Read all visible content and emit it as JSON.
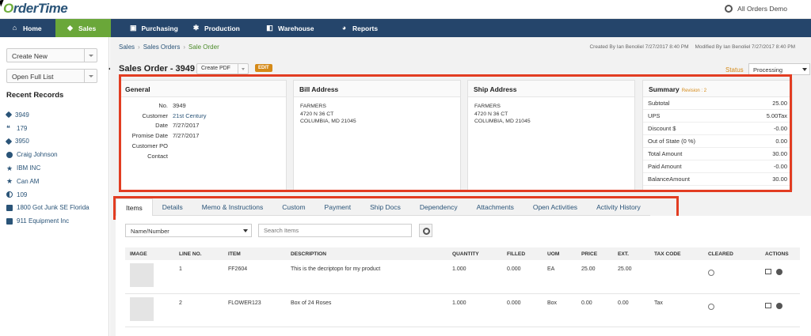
{
  "app": {
    "logo": "OrderTime",
    "account_link": "All Orders Demo"
  },
  "nav": [
    {
      "label": "Home",
      "icon": "home-icon",
      "active": false
    },
    {
      "label": "Sales",
      "icon": "tag-icon",
      "active": true
    },
    {
      "label": "Purchasing",
      "icon": "cart-icon",
      "active": false
    },
    {
      "label": "Production",
      "icon": "gears-icon",
      "active": false
    },
    {
      "label": "Warehouse",
      "icon": "box-icon",
      "active": false
    },
    {
      "label": "Reports",
      "icon": "pie-chart-icon",
      "active": false
    }
  ],
  "sidebar": {
    "create_new": "Create New",
    "open_full_list": "Open Full List",
    "recent_title": "Recent Records",
    "recent": [
      {
        "label": "3949",
        "icon": "tag-icon"
      },
      {
        "label": "179",
        "icon": "quote-icon"
      },
      {
        "label": "3950",
        "icon": "tag-icon"
      },
      {
        "label": "Craig Johnson",
        "icon": "user-icon"
      },
      {
        "label": "IBM INC",
        "icon": "star-icon"
      },
      {
        "label": "Can AM",
        "icon": "star-icon"
      },
      {
        "label": "109",
        "icon": "half-circle-icon"
      },
      {
        "label": "1800 Got Junk SE Florida",
        "icon": "vendor-icon"
      },
      {
        "label": "911 Equipment Inc",
        "icon": "vendor-icon"
      }
    ]
  },
  "breadcrumb": {
    "items": [
      "Sales",
      "Sales Orders",
      "Sale Order"
    ]
  },
  "meta": {
    "created": "Created By Ian Benoliel 7/27/2017 8:40 PM",
    "modified": "Modified By Ian Benoliel 7/27/2017 8:40 PM"
  },
  "header": {
    "title": "Sales Order - 3949",
    "create_pdf": "Create PDF",
    "edit": "EDIT",
    "status_label": "Status",
    "status_value": "Processing"
  },
  "general": {
    "title": "General",
    "fields": [
      {
        "label": "No.",
        "value": "3949",
        "link": false
      },
      {
        "label": "Customer",
        "value": "21st Century",
        "link": true
      },
      {
        "label": "Date",
        "value": "7/27/2017",
        "link": false
      },
      {
        "label": "Promise Date",
        "value": "7/27/2017",
        "link": false
      },
      {
        "label": "Customer PO",
        "value": "",
        "link": false
      },
      {
        "label": "Contact",
        "value": "",
        "link": false
      }
    ]
  },
  "bill": {
    "title": "Bill Address",
    "name": "FARMERS",
    "line1": "4720 N 36 CT",
    "line2": "COLUMBIA, MD 21045"
  },
  "ship": {
    "title": "Ship Address",
    "name": "FARMERS",
    "line1": "4720 N 36 CT",
    "line2": "COLUMBIA, MD 21045"
  },
  "summary": {
    "title": "Summary",
    "revision": "Revision : 2",
    "rows": [
      {
        "label": "Subtotal",
        "value": "25.00"
      },
      {
        "label": "UPS",
        "value": "5.00Tax"
      },
      {
        "label": "Discount $",
        "value": "-0.00"
      },
      {
        "label": "Out of State (0 %)",
        "value": "0.00"
      },
      {
        "label": "Total Amount",
        "value": "30.00"
      },
      {
        "label": "Paid Amount",
        "value": "-0.00"
      },
      {
        "label": "BalanceAmount",
        "value": "30.00"
      }
    ]
  },
  "tabs": [
    "Items",
    "Details",
    "Memo & Instructions",
    "Custom",
    "Payment",
    "Ship Docs",
    "Dependency",
    "Attachments",
    "Open Activities",
    "Activity History"
  ],
  "items_toolbar": {
    "filter_value": "Name/Number",
    "search_placeholder": "Search Items"
  },
  "items_table": {
    "columns": [
      "IMAGE",
      "LINE NO.",
      "ITEM",
      "DESCRIPTION",
      "QUANTITY",
      "FILLED",
      "UOM",
      "PRICE",
      "EXT.",
      "TAX CODE",
      "CLEARED",
      "ACTIONS"
    ],
    "rows": [
      {
        "line": "1",
        "item": "FF2604",
        "description": "This is the decriptopn for my product",
        "quantity": "1.000",
        "filled": "0.000",
        "uom": "EA",
        "price": "25.00",
        "ext": "25.00",
        "tax": ""
      },
      {
        "line": "2",
        "item": "FLOWER123",
        "description": "Box of 24 Roses",
        "quantity": "1.000",
        "filled": "0.000",
        "uom": "Box",
        "price": "0.00",
        "ext": "0.00",
        "tax": "Tax"
      }
    ]
  },
  "colors": {
    "navbar": "#25456b",
    "active_nav": "#6aa739",
    "accent_orange": "#d58a18",
    "highlight_red": "#e23d22",
    "link": "#2a5478"
  }
}
